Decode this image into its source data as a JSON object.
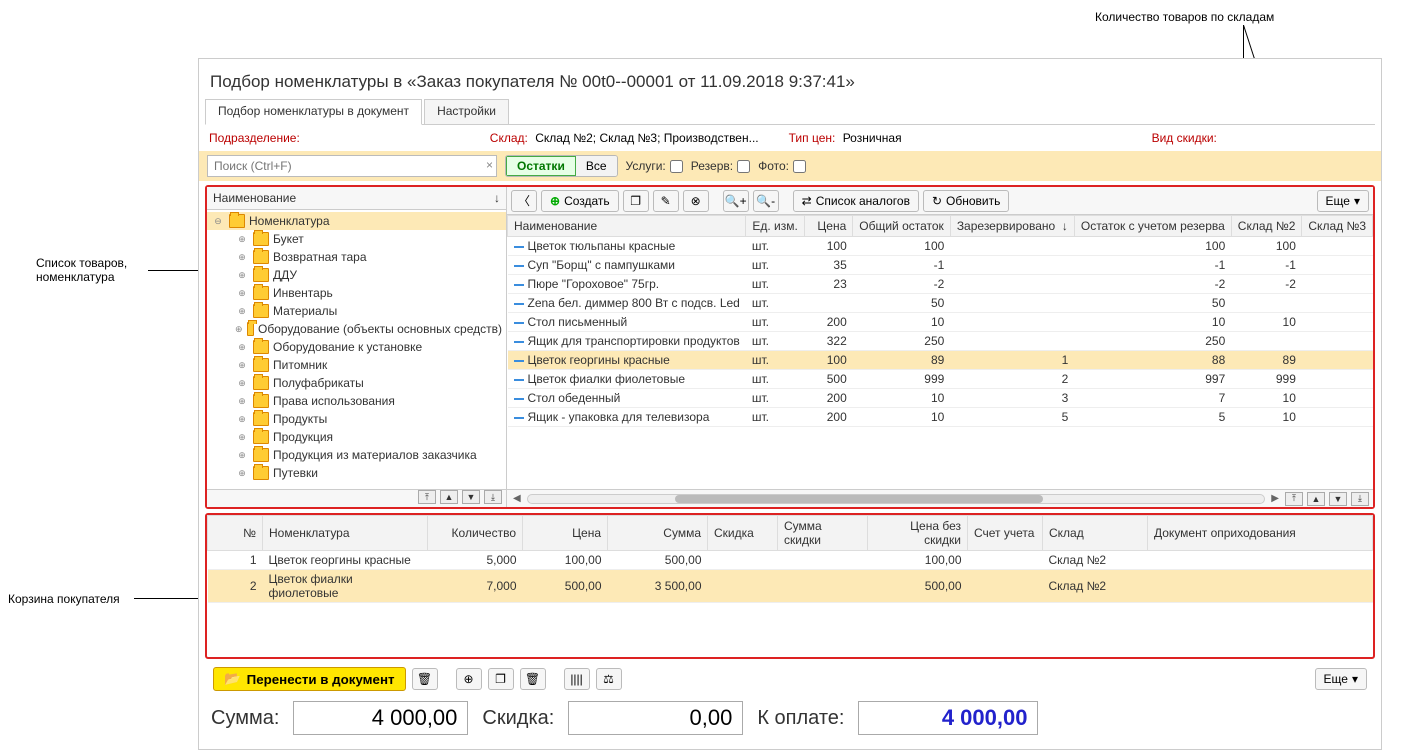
{
  "title": "Подбор номенклатуры в «Заказ покупателя № 00t0--00001 от 11.09.2018 9:37:41»",
  "tabs": {
    "t1": "Подбор номенклатуры в документ",
    "t2": "Настройки"
  },
  "labels": {
    "podrazdelenie": "Подразделение:",
    "sklad_lab": "Склад:",
    "sklad_val": "Склад №2; Склад №3; Производствен...",
    "tipcen_lab": "Тип цен:",
    "tipcen_val": "Розничная",
    "vidskidki": "Вид скидки:"
  },
  "search": {
    "placeholder": "Поиск (Ctrl+F)",
    "seg1": "Остатки",
    "seg2": "Все",
    "uslugi": "Услуги:",
    "rezerv": "Резерв:",
    "foto": "Фото:"
  },
  "tree": {
    "header": "Наименование",
    "root": "Номенклатура",
    "items": [
      "Букет",
      "Возвратная тара",
      "ДДУ",
      "Инвентарь",
      "Материалы",
      "Оборудование (объекты основных средств)",
      "Оборудование к установке",
      "Питомник",
      "Полуфабрикаты",
      "Права использования",
      "Продукты",
      "Продукция",
      "Продукция из материалов заказчика",
      "Путевки"
    ]
  },
  "toolbar": {
    "create": "Создать",
    "analogs": "Список аналогов",
    "refresh": "Обновить",
    "more": "Еще"
  },
  "list": {
    "headers": {
      "name": "Наименование",
      "ed": "Ед. изм.",
      "price": "Цена",
      "total": "Общий остаток",
      "reserved": "Зарезервировано",
      "withres": "Остаток с учетом резерва",
      "sk2": "Склад №2",
      "sk3": "Склад №3"
    },
    "rows": [
      {
        "name": "Цветок тюльпаны красные",
        "ed": "шт.",
        "price": "100",
        "total": "100",
        "res": "",
        "wr": "100",
        "s2": "100",
        "s3": ""
      },
      {
        "name": "Суп \"Борщ\" с пампушками",
        "ed": "шт.",
        "price": "35",
        "total": "-1",
        "res": "",
        "wr": "-1",
        "s2": "-1",
        "s3": ""
      },
      {
        "name": "Пюре \"Гороховое\" 75гр.",
        "ed": "шт.",
        "price": "23",
        "total": "-2",
        "res": "",
        "wr": "-2",
        "s2": "-2",
        "s3": ""
      },
      {
        "name": "Zena бел. диммер 800 Вт с подсв. Led",
        "ed": "шт.",
        "price": "",
        "total": "50",
        "res": "",
        "wr": "50",
        "s2": "",
        "s3": ""
      },
      {
        "name": "Стол письменный",
        "ed": "шт.",
        "price": "200",
        "total": "10",
        "res": "",
        "wr": "10",
        "s2": "10",
        "s3": ""
      },
      {
        "name": "Ящик для транспортировки продуктов",
        "ed": "шт.",
        "price": "322",
        "total": "250",
        "res": "",
        "wr": "250",
        "s2": "",
        "s3": ""
      },
      {
        "name": "Цветок георгины красные",
        "ed": "шт.",
        "price": "100",
        "total": "89",
        "res": "1",
        "wr": "88",
        "s2": "89",
        "s3": "",
        "sel": true
      },
      {
        "name": "Цветок фиалки фиолетовые",
        "ed": "шт.",
        "price": "500",
        "total": "999",
        "res": "2",
        "wr": "997",
        "s2": "999",
        "s3": ""
      },
      {
        "name": "Стол обеденный",
        "ed": "шт.",
        "price": "200",
        "total": "10",
        "res": "3",
        "wr": "7",
        "s2": "10",
        "s3": ""
      },
      {
        "name": "Ящик - упаковка для телевизора",
        "ed": "шт.",
        "price": "200",
        "total": "10",
        "res": "5",
        "wr": "5",
        "s2": "10",
        "s3": ""
      }
    ]
  },
  "cart": {
    "headers": {
      "n": "№",
      "nom": "Номенклатура",
      "qty": "Количество",
      "price": "Цена",
      "sum": "Сумма",
      "disc": "Скидка",
      "discsum": "Сумма скидки",
      "nod": "Цена без скидки",
      "acct": "Счет учета",
      "sklad": "Склад",
      "doc": "Документ оприходования"
    },
    "rows": [
      {
        "n": "1",
        "nom": "Цветок георгины красные",
        "qty": "5,000",
        "price": "100,00",
        "sum": "500,00",
        "disc": "",
        "ds": "",
        "nod": "100,00",
        "acct": "",
        "sklad": "Склад №2",
        "doc": ""
      },
      {
        "n": "2",
        "nom": "Цветок фиалки фиолетовые",
        "qty": "7,000",
        "price": "500,00",
        "sum": "3 500,00",
        "disc": "",
        "ds": "",
        "nod": "500,00",
        "acct": "",
        "sklad": "Склад №2",
        "doc": "",
        "sel": true
      }
    ]
  },
  "actions": {
    "transfer": "Перенести в документ",
    "more": "Еще"
  },
  "totals": {
    "sum_lab": "Сумма:",
    "sum": "4 000,00",
    "disc_lab": "Скидка:",
    "disc": "0,00",
    "pay_lab": "К оплате:",
    "pay": "4 000,00"
  },
  "annotations": {
    "tree": "Список товаров,\nноменклатура",
    "cart": "Корзина покупателя",
    "warehouses": "Количество товаров по складам"
  }
}
